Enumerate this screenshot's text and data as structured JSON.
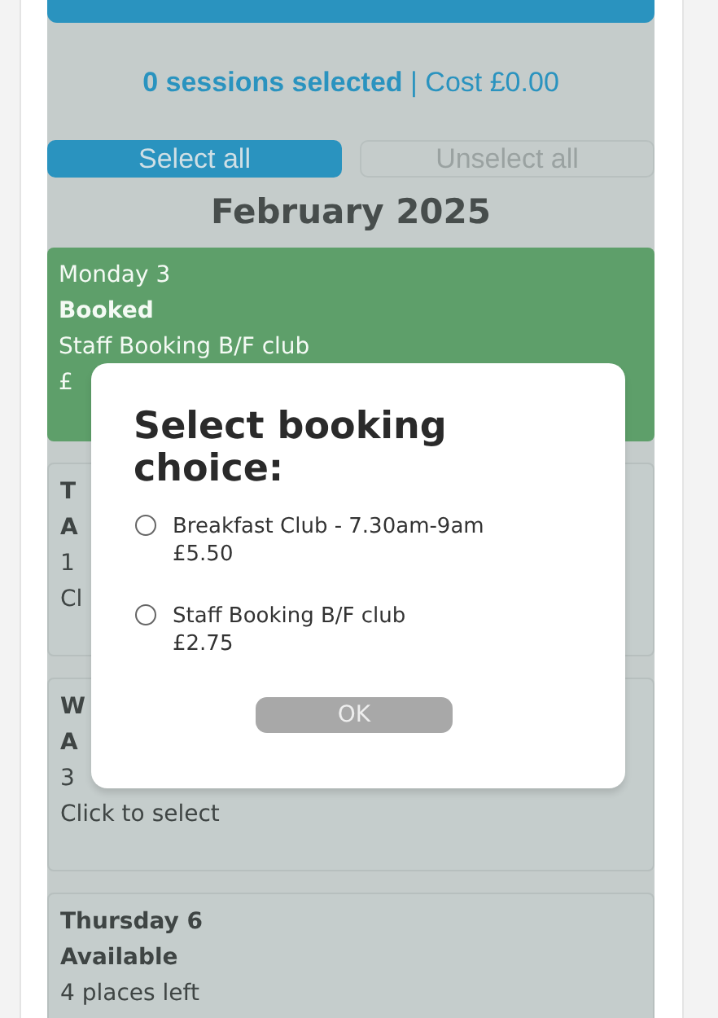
{
  "top_button": {
    "kind": "button"
  },
  "summary": "**0 sessions selected** | Cost £0.00",
  "select_buttons": [
    {
      "label": "Select all",
      "kind": "primary"
    },
    {
      "label": "Unselect all",
      "kind": "secondary"
    }
  ],
  "month": "February 2025",
  "days": [
    {
      "kind": "booked",
      "lines": [
        "Monday 3",
        "Booked",
        "Staff Booking B/F club",
        "£"
      ]
    },
    {
      "kind": "available",
      "lines": [
        "T",
        "A",
        "1",
        "Cl"
      ]
    },
    {
      "kind": "available",
      "lines": [
        "W",
        "A",
        "3",
        "Click to select"
      ]
    },
    {
      "kind": "available",
      "lines": [
        "Thursday 6",
        "Available",
        "4 places left"
      ]
    }
  ],
  "dialog": {
    "title": "Select booking choice:",
    "options": [
      {
        "name": "Breakfast Club - 7.30am-9am",
        "price": "£5.50",
        "selected": false
      },
      {
        "name": "Staff Booking B/F club",
        "price": "£2.75",
        "selected": false
      }
    ],
    "button": "OK"
  }
}
